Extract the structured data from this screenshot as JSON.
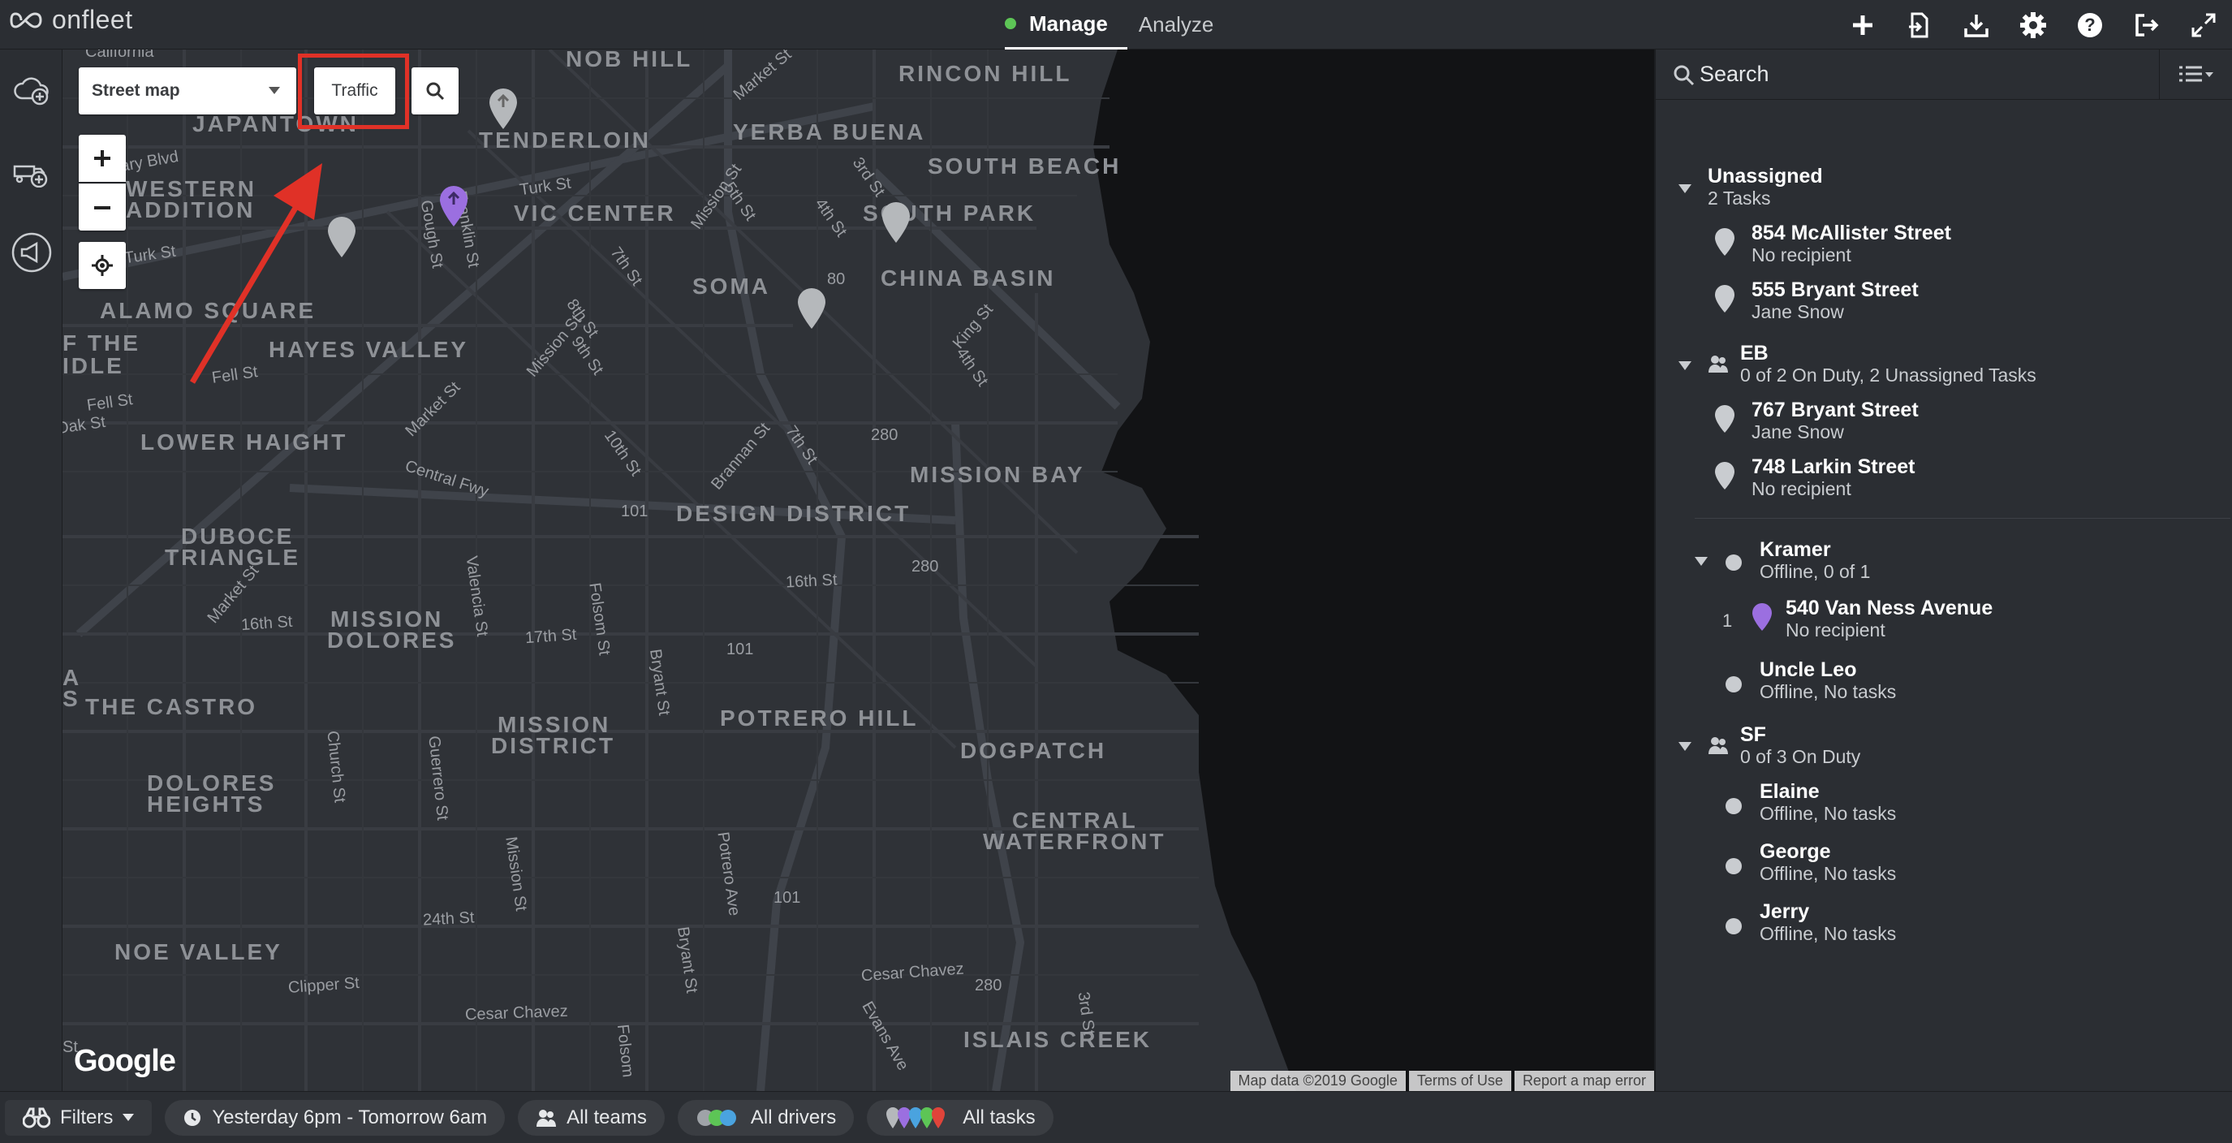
{
  "app": {
    "brand": "onfleet"
  },
  "nav": {
    "tabs": [
      {
        "label": "Manage",
        "active": true
      },
      {
        "label": "Analyze",
        "active": false
      }
    ],
    "status_color": "#5dc556"
  },
  "top_actions": [
    "plus-icon",
    "import-icon",
    "download-icon",
    "gear-icon",
    "help-icon",
    "logout-icon",
    "expand-icon"
  ],
  "map": {
    "map_type": "Street map",
    "traffic_label": "Traffic",
    "zoom_in": "+",
    "zoom_out": "−",
    "google_label": "Google",
    "attribution": {
      "data": "Map data ©2019 Google",
      "terms": "Terms of Use",
      "report": "Report a map error"
    },
    "neighborhoods": [
      "NOB HILL",
      "RINCON HILL",
      "JAPANTOWN",
      "TENDERLOIN",
      "YERBA BUENA",
      "SOUTH BEACH",
      "WESTERN",
      "ADDITION",
      "VIC CENTER",
      "SOUTH PARK",
      "CHINA BASIN",
      "SOMA",
      "ALAMO SQUARE",
      "F THE",
      "IDLE",
      "HAYES VALLEY",
      "LOWER HAIGHT",
      "MISSION BAY",
      "DESIGN DISTRICT",
      "DUBOCE",
      "TRIANGLE",
      "MISSION",
      "DOLORES",
      "A",
      "S",
      "THE CASTRO",
      "MISSION",
      "DISTRICT",
      "POTRERO HILL",
      "DOGPATCH",
      "DOLORES",
      "HEIGHTS",
      "CENTRAL",
      "WATERFRONT",
      "NOE VALLEY",
      "ISLAIS CREEK"
    ],
    "streets": [
      "California",
      "Market St",
      "eary Blvd",
      "Franklin St",
      "Turk St",
      "3rd St",
      "Mission St",
      "5th St",
      "4th St",
      "Gough St",
      "7th St",
      "80",
      "Turk St",
      "8th St",
      "King St",
      "Fell St",
      "9th St",
      "4th St",
      "Fell St",
      "Oak St",
      "Market St",
      "Mission St",
      "280",
      "10th St",
      "Brannan St",
      "7th St",
      "Central Fwy",
      "101",
      "Valencia St",
      "Folsom St",
      "280",
      "Market St",
      "16th St",
      "16th St",
      "17th St",
      "Bryant St",
      "101",
      "Church St",
      "Guerrero St",
      "Potrero Ave",
      "Mission St",
      "24th St",
      "101",
      "Bryant St",
      "Cesar Chavez",
      "280",
      "3rd St",
      "Clipper St",
      "Evans Ave",
      "Cesar Chavez",
      "Folsom",
      "St"
    ]
  },
  "panel": {
    "search_placeholder": "Search",
    "groups": [
      {
        "name": "Unassigned",
        "subtitle": "2 Tasks",
        "tasks": [
          {
            "address": "854 McAllister Street",
            "recipient": "No recipient"
          },
          {
            "address": "555 Bryant Street",
            "recipient": "Jane Snow"
          }
        ]
      },
      {
        "name": "EB",
        "subtitle": "0 of 2 On Duty, 2 Unassigned Tasks",
        "tasks": [
          {
            "address": "767 Bryant Street",
            "recipient": "Jane Snow"
          },
          {
            "address": "748 Larkin Street",
            "recipient": "No recipient"
          }
        ],
        "drivers": [
          {
            "name": "Kramer",
            "status": "Offline, 0 of 1",
            "tasks": [
              {
                "index": "1",
                "address": "540 Van Ness Avenue",
                "recipient": "No recipient",
                "color": "#9b6fe0"
              }
            ]
          },
          {
            "name": "Uncle Leo",
            "status": "Offline, No tasks"
          }
        ]
      },
      {
        "name": "SF",
        "subtitle": "0 of 3 On Duty",
        "drivers": [
          {
            "name": "Elaine",
            "status": "Offline, No tasks"
          },
          {
            "name": "George",
            "status": "Offline, No tasks"
          },
          {
            "name": "Jerry",
            "status": "Offline, No tasks"
          }
        ]
      }
    ]
  },
  "bottom": {
    "filters": "Filters",
    "time_range": "Yesterday 6pm - Tomorrow 6am",
    "teams": "All teams",
    "drivers": "All drivers",
    "tasks": "All tasks"
  },
  "colors": {
    "annotation": "#e03127",
    "pin_purple": "#9b6fe0",
    "pin_grey": "#b5b8bb"
  }
}
